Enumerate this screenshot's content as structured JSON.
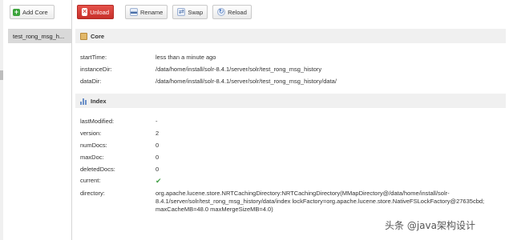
{
  "sidebar": {
    "add_core_label": "Add Core",
    "cores": [
      {
        "label": "test_rong_msg_h..."
      }
    ]
  },
  "toolbar": {
    "unload_label": "Unload",
    "rename_label": "Rename",
    "swap_label": "Swap",
    "reload_label": "Reload"
  },
  "core_section": {
    "title": "Core",
    "rows": [
      {
        "label": "startTime:",
        "value": "less than a minute ago"
      },
      {
        "label": "instanceDir:",
        "value": "/data/home/install/solr-8.4.1/server/solr/test_rong_msg_history"
      },
      {
        "label": "dataDir:",
        "value": "/data/home/install/solr-8.4.1/server/solr/test_rong_msg_history/data/"
      }
    ]
  },
  "index_section": {
    "title": "Index",
    "rows": [
      {
        "label": "lastModified:",
        "value": "-"
      },
      {
        "label": "version:",
        "value": "2"
      },
      {
        "label": "numDocs:",
        "value": "0"
      },
      {
        "label": "maxDoc:",
        "value": "0"
      },
      {
        "label": "deletedDocs:",
        "value": "0"
      },
      {
        "label": "current:",
        "value": ""
      },
      {
        "label": "directory:",
        "value": "org.apache.lucene.store.NRTCachingDirectory:NRTCachingDirectory(MMapDirectory@/data/home/install/solr-8.4.1/server/solr/test_rong_msg_history/data/index lockFactory=org.apache.lucene.store.NativeFSLockFactory@27635cbd; maxCacheMB=48.0 maxMergeSizeMB=4.0)"
      }
    ]
  },
  "icons": {
    "add": "plus-icon",
    "unload": "x-icon",
    "rename": "rename-icon",
    "swap": "swap-icon",
    "reload": "reload-icon",
    "core": "core-icon",
    "index": "bar-chart-icon",
    "current": "checkmark-icon"
  },
  "colors": {
    "unload_button": "#d9403a",
    "section_header_bg": "#f0f0f0",
    "selected_core_bg": "#d9d9d9",
    "check_green": "#43a047"
  },
  "watermark": "头条 @java架构设计"
}
